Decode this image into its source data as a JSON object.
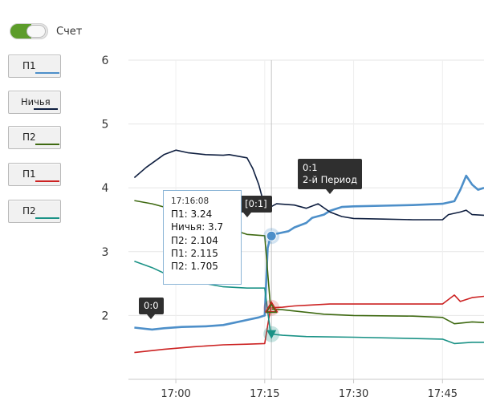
{
  "toggle": {
    "label": "Счет",
    "on": true,
    "accent": "#5c9c2a"
  },
  "legend": [
    {
      "label": "П1",
      "color": "#4d8fc9"
    },
    {
      "label": "Ничья",
      "color": "#0f1f40"
    },
    {
      "label": "П2",
      "color": "#3f6a12"
    },
    {
      "label": "П1",
      "color": "#cc2222"
    },
    {
      "label": "П2",
      "color": "#1a9286"
    }
  ],
  "tooltip": {
    "time": "17:16:08",
    "lines": [
      "П1: 3.24",
      "Ничья: 3.7",
      "П2: 2.104",
      "П1: 2.115",
      "П2: 1.705"
    ]
  },
  "flags": {
    "score_start": "0:0",
    "score_mid": "0:1 [0:1]",
    "period_line1": "0:1",
    "period_line2": "2-й Период"
  },
  "chart_data": {
    "type": "line",
    "x_unit": "time (HH:MM)",
    "xlim": [
      "16:52",
      "17:52"
    ],
    "xticks": [
      "17:00",
      "17:15",
      "17:30",
      "17:45"
    ],
    "ylim": [
      1,
      6
    ],
    "yticks": [
      2,
      3,
      4,
      5,
      6
    ],
    "grid": true,
    "crosshair_x": "17:16:08",
    "series": [
      {
        "name": "П1",
        "color": "#4d8fc9",
        "width": 2.6,
        "points": [
          [
            "16:53",
            1.81
          ],
          [
            "16:56",
            1.78
          ],
          [
            "16:58",
            1.8
          ],
          [
            "17:01",
            1.82
          ],
          [
            "17:05",
            1.83
          ],
          [
            "17:08",
            1.85
          ],
          [
            "17:10",
            1.89
          ],
          [
            "17:12",
            1.93
          ],
          [
            "17:14",
            1.97
          ],
          [
            "17:15",
            2.0
          ],
          [
            "17:15:30",
            3.06
          ],
          [
            "17:16",
            3.24
          ],
          [
            "17:17",
            3.28
          ],
          [
            "17:19",
            3.32
          ],
          [
            "17:20",
            3.38
          ],
          [
            "17:22",
            3.45
          ],
          [
            "17:23",
            3.53
          ],
          [
            "17:25",
            3.58
          ],
          [
            "17:26",
            3.64
          ],
          [
            "17:28",
            3.7
          ],
          [
            "17:30",
            3.71
          ],
          [
            "17:35",
            3.72
          ],
          [
            "17:40",
            3.73
          ],
          [
            "17:45",
            3.75
          ],
          [
            "17:47",
            3.79
          ],
          [
            "17:48",
            3.97
          ],
          [
            "17:49",
            4.19
          ],
          [
            "17:50",
            4.05
          ],
          [
            "17:51",
            3.97
          ],
          [
            "17:52",
            4.0
          ]
        ]
      },
      {
        "name": "Ничья",
        "color": "#0f1f40",
        "width": 1.6,
        "points": [
          [
            "16:53",
            4.16
          ],
          [
            "16:55",
            4.32
          ],
          [
            "16:58",
            4.52
          ],
          [
            "17:00",
            4.59
          ],
          [
            "17:02",
            4.55
          ],
          [
            "17:05",
            4.52
          ],
          [
            "17:08",
            4.51
          ],
          [
            "17:09",
            4.52
          ],
          [
            "17:12",
            4.47
          ],
          [
            "17:13",
            4.3
          ],
          [
            "17:14",
            4.05
          ],
          [
            "17:15",
            3.7
          ],
          [
            "17:16",
            3.7
          ],
          [
            "17:17",
            3.75
          ],
          [
            "17:20",
            3.73
          ],
          [
            "17:22",
            3.68
          ],
          [
            "17:24",
            3.75
          ],
          [
            "17:26",
            3.62
          ],
          [
            "17:28",
            3.55
          ],
          [
            "17:30",
            3.52
          ],
          [
            "17:35",
            3.51
          ],
          [
            "17:40",
            3.5
          ],
          [
            "17:45",
            3.5
          ],
          [
            "17:46",
            3.58
          ],
          [
            "17:48",
            3.62
          ],
          [
            "17:49",
            3.65
          ],
          [
            "17:50",
            3.58
          ],
          [
            "17:52",
            3.57
          ]
        ]
      },
      {
        "name": "П2",
        "color": "#3f6a12",
        "width": 1.6,
        "points": [
          [
            "16:53",
            3.8
          ],
          [
            "16:56",
            3.75
          ],
          [
            "16:58",
            3.7
          ],
          [
            "17:00",
            3.6
          ],
          [
            "17:01",
            3.51
          ],
          [
            "17:03",
            3.48
          ],
          [
            "17:06",
            3.43
          ],
          [
            "17:09",
            3.36
          ],
          [
            "17:12",
            3.27
          ],
          [
            "17:15",
            3.25
          ],
          [
            "17:16",
            2.1
          ],
          [
            "17:18",
            2.09
          ],
          [
            "17:20",
            2.07
          ],
          [
            "17:25",
            2.02
          ],
          [
            "17:30",
            2.0
          ],
          [
            "17:40",
            1.99
          ],
          [
            "17:45",
            1.97
          ],
          [
            "17:47",
            1.87
          ],
          [
            "17:50",
            1.9
          ],
          [
            "17:52",
            1.89
          ]
        ]
      },
      {
        "name": "П1",
        "color": "#cc2222",
        "width": 1.6,
        "points": [
          [
            "16:53",
            1.42
          ],
          [
            "16:58",
            1.47
          ],
          [
            "17:03",
            1.51
          ],
          [
            "17:08",
            1.54
          ],
          [
            "17:12",
            1.55
          ],
          [
            "17:15",
            1.56
          ],
          [
            "17:16",
            2.12
          ],
          [
            "17:18",
            2.13
          ],
          [
            "17:20",
            2.15
          ],
          [
            "17:22",
            2.16
          ],
          [
            "17:26",
            2.18
          ],
          [
            "17:30",
            2.18
          ],
          [
            "17:40",
            2.18
          ],
          [
            "17:45",
            2.18
          ],
          [
            "17:47",
            2.32
          ],
          [
            "17:48",
            2.22
          ],
          [
            "17:50",
            2.28
          ],
          [
            "17:52",
            2.3
          ]
        ]
      },
      {
        "name": "П2",
        "color": "#1a9286",
        "width": 1.6,
        "points": [
          [
            "16:53",
            2.85
          ],
          [
            "16:56",
            2.75
          ],
          [
            "16:59",
            2.62
          ],
          [
            "17:02",
            2.55
          ],
          [
            "17:05",
            2.5
          ],
          [
            "17:08",
            2.45
          ],
          [
            "17:12",
            2.43
          ],
          [
            "17:15",
            2.43
          ],
          [
            "17:16",
            1.71
          ],
          [
            "17:18",
            1.69
          ],
          [
            "17:22",
            1.67
          ],
          [
            "17:30",
            1.66
          ],
          [
            "17:40",
            1.64
          ],
          [
            "17:45",
            1.63
          ],
          [
            "17:47",
            1.56
          ],
          [
            "17:50",
            1.58
          ],
          [
            "17:52",
            1.58
          ]
        ]
      }
    ]
  }
}
